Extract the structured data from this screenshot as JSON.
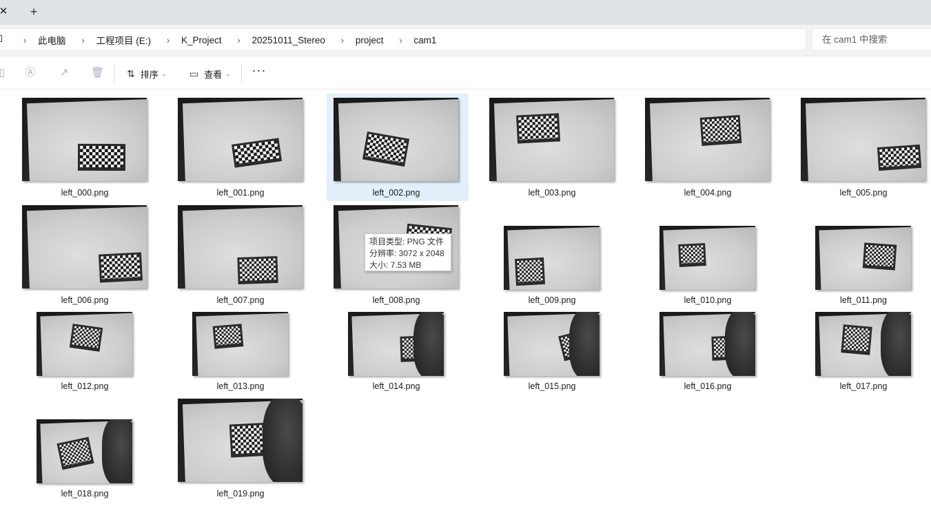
{
  "tabs": {
    "close_glyph": "✕",
    "new_glyph": "+"
  },
  "breadcrumb": {
    "items": [
      "此电脑",
      "工程项目 (E:)",
      "K_Project",
      "20251011_Stereo",
      "project",
      "cam1"
    ],
    "separator": "›"
  },
  "search": {
    "placeholder": "在 cam1 中搜索"
  },
  "toolbar": {
    "sort_label": "排序",
    "view_label": "查看",
    "more_label": "···"
  },
  "files": [
    "left_000.png",
    "left_001.png",
    "left_002.png",
    "left_003.png",
    "left_004.png",
    "left_005.png",
    "left_006.png",
    "left_007.png",
    "left_008.png",
    "left_009.png",
    "left_010.png",
    "left_011.png",
    "left_012.png",
    "left_013.png",
    "left_014.png",
    "left_015.png",
    "left_016.png",
    "left_017.png",
    "left_018.png",
    "left_019.png"
  ],
  "selected_index": 2,
  "tooltip": {
    "type_line": "项目类型: PNG 文件",
    "res_line": "分辨率: 3072 x 2048",
    "size_line": "大小: 7.53 MB"
  },
  "colors": {
    "selection": "#e3effb",
    "tabstrip": "#dfe3e8"
  }
}
